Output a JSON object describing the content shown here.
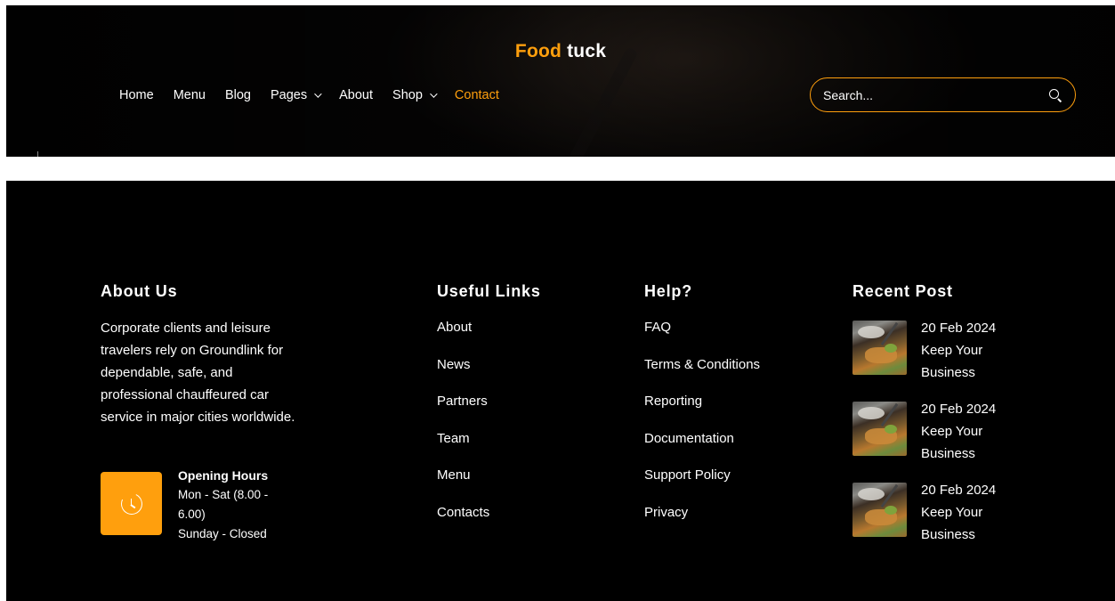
{
  "header": {
    "logo": {
      "part1": "Food",
      "part2": "tuck"
    },
    "nav": [
      {
        "label": "Home",
        "dropdown": false,
        "active": false
      },
      {
        "label": "Menu",
        "dropdown": false,
        "active": false
      },
      {
        "label": "Blog",
        "dropdown": false,
        "active": false
      },
      {
        "label": "Pages",
        "dropdown": true,
        "active": false
      },
      {
        "label": "About",
        "dropdown": false,
        "active": false
      },
      {
        "label": "Shop",
        "dropdown": true,
        "active": false
      },
      {
        "label": "Contact",
        "dropdown": false,
        "active": true
      }
    ],
    "search": {
      "placeholder": "Search...",
      "icon": "search-icon"
    }
  },
  "footer": {
    "about": {
      "title": "About Us",
      "text": "Corporate clients and leisure travelers rely on Groundlink for dependable, safe, and professional chauffeured car service in major cities worldwide.",
      "hours": {
        "icon": "clock-icon",
        "title": "Opening Hours",
        "weekdays": "Mon - Sat (8.00 - 6.00)",
        "sunday": "Sunday - Closed"
      }
    },
    "useful_links": {
      "title": "Useful Links",
      "items": [
        "About",
        "News",
        "Partners",
        "Team",
        "Menu",
        "Contacts"
      ]
    },
    "help": {
      "title": "Help?",
      "items": [
        "FAQ",
        "Terms & Conditions",
        "Reporting",
        "Documentation",
        "Support Policy",
        "Privacy"
      ]
    },
    "recent_posts": {
      "title": "Recent Post",
      "items": [
        {
          "date": "20 Feb 2024",
          "title": "Keep Your Business"
        },
        {
          "date": "20 Feb 2024",
          "title": "Keep Your Business"
        },
        {
          "date": "20 Feb 2024",
          "title": "Keep Your Business"
        }
      ]
    }
  },
  "colors": {
    "accent": "#FF9F0D",
    "background": "#000000",
    "text": "#FFFFFF"
  }
}
